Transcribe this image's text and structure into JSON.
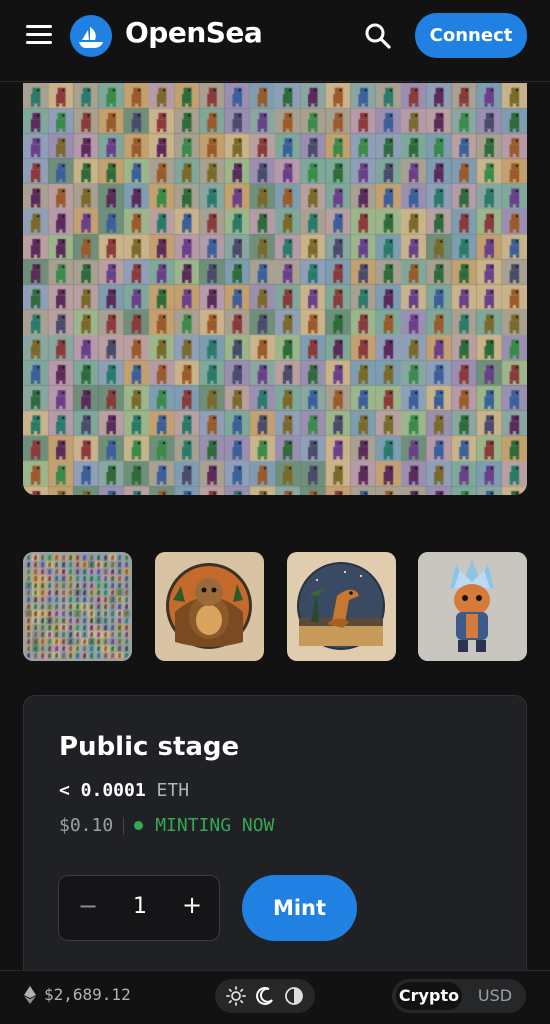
{
  "header": {
    "brand": "OpenSea",
    "connect_label": "Connect"
  },
  "icons": {
    "menu": "menu-icon",
    "logo": "opensea-logo",
    "search": "search-icon",
    "ethereum": "ethereum-icon",
    "sun": "sun-icon",
    "moon": "moon-icon",
    "contrast": "contrast-icon"
  },
  "hero": {
    "description_icon": "pixel-dinosaur-grid"
  },
  "thumbnails": [
    {
      "name": "collection-grid",
      "selected": true
    },
    {
      "name": "dino-shell",
      "selected": false
    },
    {
      "name": "dino-sunset",
      "selected": false
    },
    {
      "name": "dino-crystal-hood",
      "selected": false
    }
  ],
  "mint": {
    "stage_title": "Public stage",
    "price_value": "< 0.0001",
    "price_unit": "ETH",
    "usd_value": "$0.10",
    "status": "MINTING NOW",
    "quantity": "1",
    "minus_label": "−",
    "plus_label": "+",
    "mint_label": "Mint"
  },
  "footer": {
    "eth_price": "$2,689.12",
    "currency_crypto": "Crypto",
    "currency_usd": "USD"
  },
  "colors": {
    "accent": "#2081e2",
    "status_green": "#34a853",
    "background": "#121212",
    "card": "#202124"
  }
}
